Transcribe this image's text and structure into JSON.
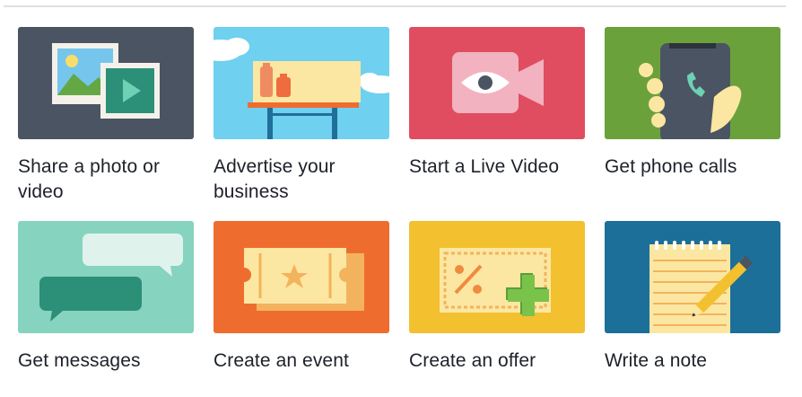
{
  "cards": [
    {
      "label": "Share a photo or video",
      "icon": "photo-icon",
      "bg": "#4b5462"
    },
    {
      "label": "Advertise your business",
      "icon": "billboard-icon",
      "bg": "#6fd0ef"
    },
    {
      "label": "Start a Live Video",
      "icon": "video-camera-icon",
      "bg": "#e14d60"
    },
    {
      "label": "Get phone calls",
      "icon": "phone-icon",
      "bg": "#6ba13b"
    },
    {
      "label": "Get messages",
      "icon": "chat-bubbles-icon",
      "bg": "#86d3c0"
    },
    {
      "label": "Create an event",
      "icon": "ticket-icon",
      "bg": "#ef6c2f"
    },
    {
      "label": "Create an offer",
      "icon": "coupon-icon",
      "bg": "#f3c02f"
    },
    {
      "label": "Write a note",
      "icon": "notepad-icon",
      "bg": "#1c6f99"
    }
  ]
}
